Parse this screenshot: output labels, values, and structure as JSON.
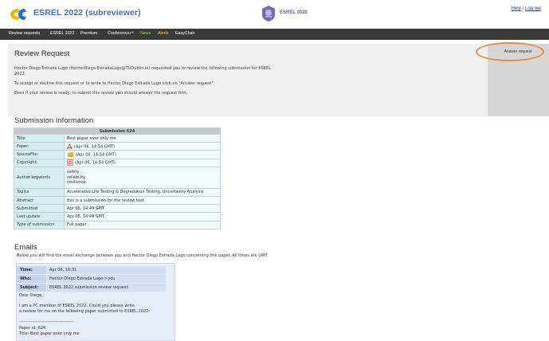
{
  "header": {
    "app_title": "ESREL 2022 (subreviewer)",
    "conf_logo_text": "ESREL 2022",
    "help": "Help",
    "separator": "/",
    "logout": "Log out",
    "brand_color": "#3b6fb5"
  },
  "nav": {
    "items": [
      "Review requests",
      "ESREL 2022",
      "Premium",
      "Conference",
      "News",
      "Alerts",
      "EasyChair"
    ]
  },
  "request": {
    "title": "Review Request",
    "line1": "Hector Diego Estrada Lugo (HectorDiego.EstradaLugo@TUDublin.ie) requested you to review the following submission for ESREL",
    "line2": "2022.",
    "line3": "To accept or decline this request or to write to Hector Diego Estrada Lugo click on \"Answer request\".",
    "line4": "Even if your review is ready, to submit this review you should answer the request first.",
    "answer_button": "Answer request",
    "highlight_color": "#ec8a3d"
  },
  "submission": {
    "section_title": "Submission Information",
    "table_title": "Submission 624",
    "rows": [
      {
        "label": "Title",
        "value": "Best paper ever only me"
      },
      {
        "label": "Paper:",
        "value": "(Apr 06, 14:54 GMT)"
      },
      {
        "label": "SourceFile:",
        "value": "(Apr 06, 14:54 GMT)"
      },
      {
        "label": "Copyright:",
        "value": "(Apr 06, 14:54 GMT)"
      },
      {
        "label": "Author keywords",
        "value": [
          "safety",
          "reliability",
          "resilience"
        ]
      },
      {
        "label": "Topics",
        "value": "Accelerated Life Testing & Degradation Testing, Uncertainty Analysis"
      },
      {
        "label": "Abstract",
        "value": "this is a submission for the review test"
      },
      {
        "label": "Submitted",
        "value": "Apr 06, 14:49 GMT"
      },
      {
        "label": "Last update",
        "value": "Apr 06, 14:49 GMT"
      },
      {
        "label": "Type of submission",
        "value": "Full paper"
      }
    ]
  },
  "emails": {
    "section_title": "Emails",
    "description": "Below you will find the email exchange between you and Hector Diego Estrada Lugo concerning this paper. All times are GMT.",
    "time_label": "Time:",
    "time_value": "Apr 06, 16:31",
    "who_label": "Who:",
    "who_value": "Hector Diego Estrada Lugo->you",
    "subject_label": "Subject:",
    "subject_value": "ESREL 2022 submission review request",
    "body": [
      "Dear Diego,",
      "I am a PC member of ESREL 2022. Could you please write",
      "a review for me on the following paper submitted to ESREL 2022:",
      "--------------------------------------",
      "Paper id: 624",
      "Title: Best paper ever only me"
    ]
  }
}
